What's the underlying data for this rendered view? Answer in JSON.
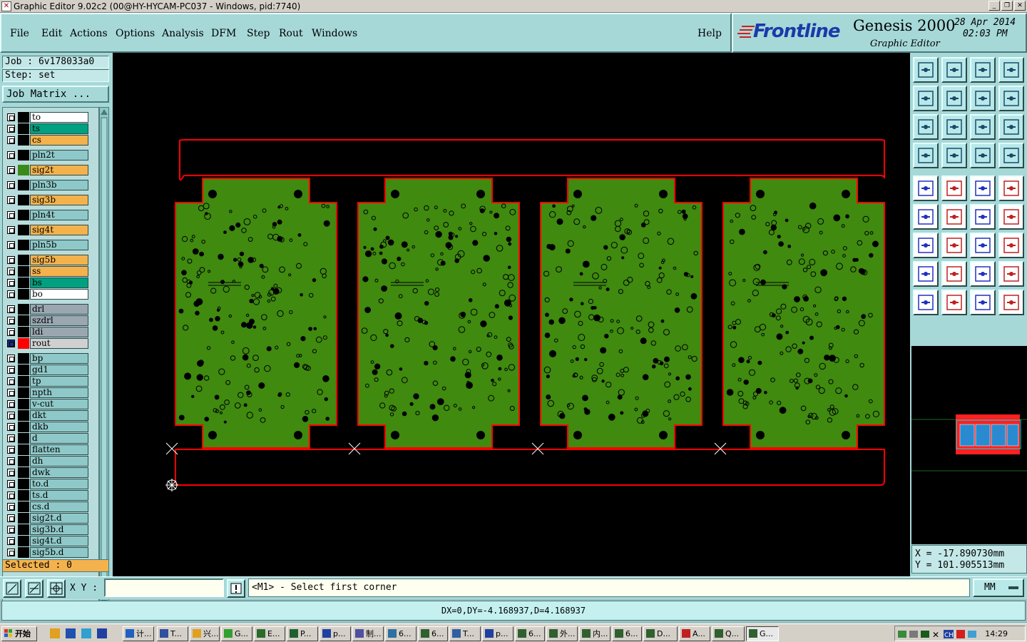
{
  "titlebar": {
    "title": "Graphic Editor 9.02c2 (00@HY-HYCAM-PC037 - Windows, pid:7740)",
    "minimize": "_",
    "restore": "❐",
    "close": "✕"
  },
  "menu": [
    "File",
    "Edit",
    "Actions",
    "Options",
    "Analysis",
    "DFM",
    "Step",
    "Rout",
    "Windows"
  ],
  "help": "Help",
  "brand": {
    "logo": "Frontline",
    "product": "Genesis 2000",
    "subtitle": "Graphic Editor",
    "date": "28 Apr 2014",
    "time": "02:03 PM"
  },
  "job": {
    "job": "Job  : 6v178033a0",
    "step": "Step: set",
    "matrix_button": "Job Matrix ..."
  },
  "layers": [
    {
      "name": "to",
      "color": "#ffffff",
      "swatch": "#000000"
    },
    {
      "name": "ts",
      "color": "#00a080",
      "swatch": "#000000"
    },
    {
      "name": "cs",
      "color": "#f4b24c",
      "swatch": "#000000"
    },
    {
      "name": "pln2t",
      "color": "#8fc8c8",
      "swatch": "#000000"
    },
    {
      "name": "sig2t",
      "color": "#f4b24c",
      "swatch": "#3a8a1a"
    },
    {
      "name": "pln3b",
      "color": "#8fc8c8",
      "swatch": "#000000"
    },
    {
      "name": "sig3b",
      "color": "#f4b24c",
      "swatch": "#000000"
    },
    {
      "name": "pln4t",
      "color": "#8fc8c8",
      "swatch": "#000000"
    },
    {
      "name": "sig4t",
      "color": "#f4b24c",
      "swatch": "#000000"
    },
    {
      "name": "pln5b",
      "color": "#8fc8c8",
      "swatch": "#000000"
    },
    {
      "name": "sig5b",
      "color": "#f4b24c",
      "swatch": "#000000"
    },
    {
      "name": "ss",
      "color": "#f4b24c",
      "swatch": "#000000"
    },
    {
      "name": "bs",
      "color": "#00a080",
      "swatch": "#000000"
    },
    {
      "name": "bo",
      "color": "#ffffff",
      "swatch": "#000000"
    },
    {
      "name": "drl",
      "color": "#9aa6b0",
      "swatch": "#000000"
    },
    {
      "name": "szdrl",
      "color": "#9aa6b0",
      "swatch": "#000000"
    },
    {
      "name": "ldi",
      "color": "#9aa6b0",
      "swatch": "#000000"
    },
    {
      "name": "rout",
      "color": "#d0d0d0",
      "swatch": "#ff0000"
    },
    {
      "name": "bp",
      "color": "#8fc8c8",
      "swatch": "#000000"
    },
    {
      "name": "gd1",
      "color": "#8fc8c8",
      "swatch": "#000000"
    },
    {
      "name": "tp",
      "color": "#8fc8c8",
      "swatch": "#000000"
    },
    {
      "name": "npth",
      "color": "#8fc8c8",
      "swatch": "#000000"
    },
    {
      "name": "v-cut",
      "color": "#8fc8c8",
      "swatch": "#000000"
    },
    {
      "name": "dkt",
      "color": "#8fc8c8",
      "swatch": "#000000"
    },
    {
      "name": "dkb",
      "color": "#8fc8c8",
      "swatch": "#000000"
    },
    {
      "name": "d",
      "color": "#8fc8c8",
      "swatch": "#000000"
    },
    {
      "name": "flatten",
      "color": "#8fc8c8",
      "swatch": "#000000"
    },
    {
      "name": "dh",
      "color": "#8fc8c8",
      "swatch": "#000000"
    },
    {
      "name": "dwk",
      "color": "#8fc8c8",
      "swatch": "#000000"
    },
    {
      "name": "to.d",
      "color": "#8fc8c8",
      "swatch": "#000000"
    },
    {
      "name": "ts.d",
      "color": "#8fc8c8",
      "swatch": "#000000"
    },
    {
      "name": "cs.d",
      "color": "#8fc8c8",
      "swatch": "#000000"
    },
    {
      "name": "sig2t.d",
      "color": "#8fc8c8",
      "swatch": "#000000"
    },
    {
      "name": "sig3b.d",
      "color": "#8fc8c8",
      "swatch": "#000000"
    },
    {
      "name": "sig4t.d",
      "color": "#8fc8c8",
      "swatch": "#000000"
    },
    {
      "name": "sig5b.d",
      "color": "#8fc8c8",
      "swatch": "#000000"
    }
  ],
  "selected": "Selected : 0",
  "coords": {
    "x": "X = -17.890730mm",
    "y": "Y = 101.905513mm"
  },
  "xy_label": "X Y :",
  "xy_value": "",
  "prompt": "<M1> - Select first corner",
  "units": "MM",
  "measure": "DX=0,DY=-4.168937,D=4.168937",
  "canvas_colors": {
    "board": "#3f8a0f",
    "outline": "#ff0000"
  },
  "tools": [
    "zoom-home-icon",
    "zoom-in-icon",
    "zoom-out-icon",
    "zoom-window-icon",
    "pan-left-icon",
    "pan-right-icon",
    "undo-view-icon",
    "redraw-icon",
    "fit-icon",
    "fit-all-icon",
    "scale-1-2-icon",
    "help-icon",
    "snap-icon",
    "display-mode-icon",
    "layer-feature-icon",
    "layer-select-icon",
    "fill-mode-icon",
    "edit-outline-icon",
    "ruler-icon",
    "circle-icon",
    "line-icon",
    "delete-icon",
    "move-icon",
    "copy-icon",
    "angle-icon",
    "arc-cw-icon",
    "arc-ccw-icon",
    "split-icon",
    "polygon-icon",
    "straight-icon",
    "measure-icon",
    "transform-icon",
    "select-icon",
    "select-box-icon",
    "select-area-icon",
    "select-net-icon"
  ],
  "taskbar": {
    "start": "开始",
    "clock": "14:29",
    "tasks": [
      "计...",
      "T...",
      "兴...",
      "G...",
      "E...",
      "P...",
      "p...",
      "制...",
      "6...",
      "6...",
      "T...",
      "p...",
      "6...",
      "外...",
      "内...",
      "6...",
      "D...",
      "A...",
      "Q...",
      "G..."
    ]
  }
}
